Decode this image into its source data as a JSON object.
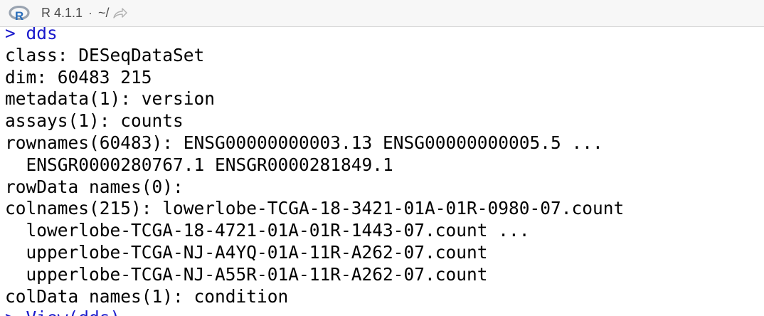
{
  "header": {
    "r_version": "R 4.1.1",
    "separator": "·",
    "working_dir": "~/",
    "logo_icon": "r-logo-icon",
    "link_icon": "goto-directory-icon"
  },
  "colors": {
    "command": "#1a1acc",
    "output": "#000000",
    "header_bg": "#f7f7f7",
    "logo_blue": "#2a6ebb"
  },
  "console": {
    "prompt_command": "> dds",
    "output_lines": [
      "class: DESeqDataSet",
      "dim: 60483 215",
      "metadata(1): version",
      "assays(1): counts",
      "rownames(60483): ENSG00000000003.13 ENSG00000000005.5 ...",
      "  ENSGR0000280767.1 ENSGR0000281849.1",
      "rowData names(0):",
      "colnames(215): lowerlobe-TCGA-18-3421-01A-01R-0980-07.count",
      "  lowerlobe-TCGA-18-4721-01A-01R-1443-07.count ...",
      "  upperlobe-TCGA-NJ-A4YQ-01A-11R-A262-07.count",
      "  upperlobe-TCGA-NJ-A55R-01A-11R-A262-07.count",
      "colData names(1): condition"
    ],
    "next_command_partial": "> View(dds)"
  }
}
